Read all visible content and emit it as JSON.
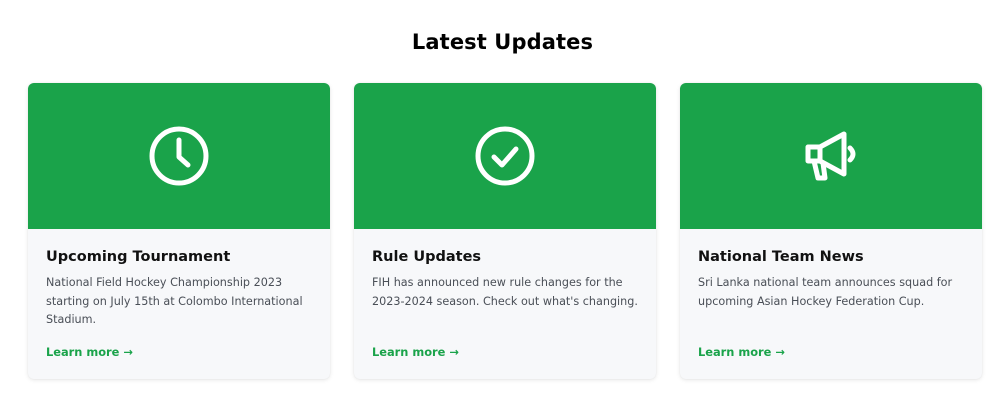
{
  "section": {
    "title": "Latest Updates"
  },
  "theme": {
    "accent": "#1aa34a",
    "card_bg": "#f7f8fa"
  },
  "cards": [
    {
      "icon": "clock-icon",
      "title": "Upcoming Tournament",
      "text": "National Field Hockey Championship 2023 starting on July 15th at Colombo International Stadium.",
      "link": "Learn more →"
    },
    {
      "icon": "check-circle-icon",
      "title": "Rule Updates",
      "text": "FIH has announced new rule changes for the 2023-2024 season. Check out what's changing.",
      "link": "Learn more →"
    },
    {
      "icon": "megaphone-icon",
      "title": "National Team News",
      "text": "Sri Lanka national team announces squad for upcoming Asian Hockey Federation Cup.",
      "link": "Learn more →"
    }
  ]
}
